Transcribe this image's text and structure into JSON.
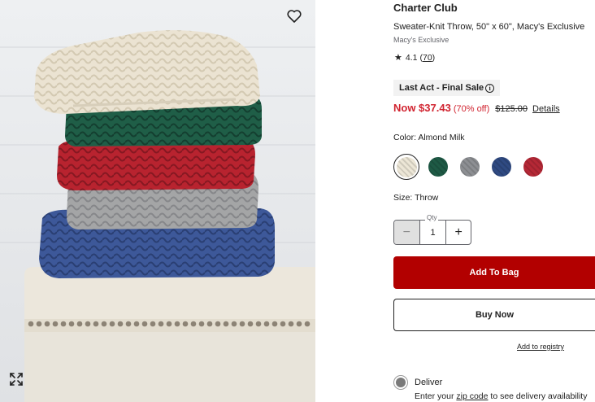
{
  "product": {
    "brand": "Charter Club",
    "name": "Sweater-Knit Throw, 50\" x 60\", Macy's Exclusive",
    "exclusive": "Macy's Exclusive",
    "rating": "4.1",
    "review_count": "70",
    "badge": "Last Act - Final Sale",
    "price": {
      "now": "Now $37.43",
      "discount": "(70% off)",
      "original": "$125.00",
      "details_link": "Details"
    },
    "color_label": "Color: Almond Milk",
    "size_label": "Size: Throw",
    "quantity": {
      "label": "Qty",
      "value": "1",
      "minus_symbol": "−",
      "plus_symbol": "+"
    },
    "add_to_bag": "Add To Bag",
    "buy_now": "Buy Now",
    "add_to_registry": "Add to registry",
    "delivery": {
      "label": "Deliver",
      "prefix": "Enter your",
      "zip_link": "zip code",
      "suffix": "to see delivery availability"
    }
  },
  "swatches": [
    {
      "name": "Almond Milk",
      "color": "#ece6d6",
      "selected": true
    },
    {
      "name": "Green",
      "color": "#1e5a45",
      "selected": false
    },
    {
      "name": "Gray",
      "color": "#8d8f93",
      "selected": false
    },
    {
      "name": "Blue",
      "color": "#2f4a82",
      "selected": false
    },
    {
      "name": "Red",
      "color": "#b52836",
      "selected": false
    }
  ],
  "icons": {
    "favorite": "heart-icon",
    "zoom": "expand-icon",
    "rating": "star-icon",
    "info": "info-icon"
  },
  "colors": {
    "sale_red": "#d12430",
    "bag_button": "#b20000"
  }
}
